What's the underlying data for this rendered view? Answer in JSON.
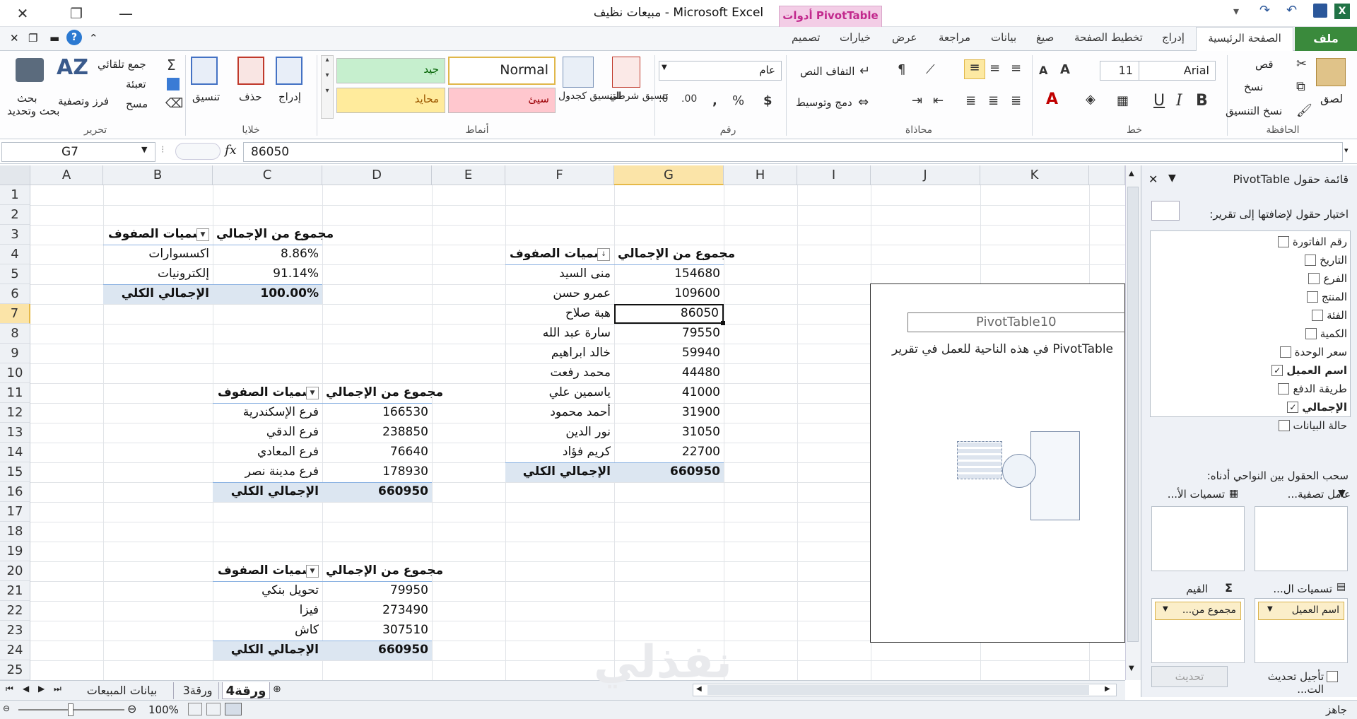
{
  "window": {
    "title": "مبيعات نظيف  -  Microsoft Excel",
    "context_tab": "أدوات PivotTable"
  },
  "tabs": {
    "file": "ملف",
    "home": "الصفحة الرئيسية",
    "insert": "إدراج",
    "page_layout": "تخطيط الصفحة",
    "formulas": "صيغ",
    "data": "بيانات",
    "review": "مراجعة",
    "view": "عرض",
    "options": "خيارات",
    "design": "تصميم"
  },
  "ribbon": {
    "clipboard": {
      "label": "الحافظة",
      "paste": "لصق",
      "cut": "قص",
      "copy": "نسخ",
      "format_painter": "نسخ التنسيق"
    },
    "font": {
      "label": "خط",
      "name": "Arial",
      "size": "11",
      "bold": "B",
      "italic": "I",
      "underline": "U"
    },
    "alignment": {
      "label": "محاذاة",
      "wrap": "التفاف النص",
      "merge": "دمج وتوسيط"
    },
    "number": {
      "label": "رقم",
      "format": "عام"
    },
    "styles": {
      "label": "أنماط",
      "conditional": "تنسيق شرطي",
      "as_table": "التنسيق كجدول",
      "normal": "Normal",
      "good": "جيد",
      "bad": "سيئ",
      "neutral": "محايد"
    },
    "cells": {
      "label": "خلايا",
      "insert": "إدراج",
      "delete": "حذف",
      "format": "تنسيق"
    },
    "editing": {
      "label": "تحرير",
      "autosum": "جمع تلقائي",
      "fill": "تعبئة",
      "clear": "مسح",
      "sort": "فرز وتصفية",
      "find": "بحث وتحديد"
    }
  },
  "formula_bar": {
    "namebox": "G7",
    "fx": "fx",
    "value": "86050"
  },
  "columns": [
    "A",
    "B",
    "C",
    "D",
    "E",
    "F",
    "G",
    "H",
    "I",
    "J",
    "K"
  ],
  "rows": [
    "1",
    "2",
    "3",
    "4",
    "5",
    "6",
    "7",
    "8",
    "9",
    "10",
    "11",
    "12",
    "13",
    "14",
    "15",
    "16",
    "17",
    "18",
    "19",
    "20",
    "21",
    "22",
    "23",
    "24",
    "25"
  ],
  "pivot1": {
    "header_sum": "مجموع من الإجمالي",
    "header_rows": "تسميات الصفوف",
    "rows": [
      {
        "label": "اكسسوارات",
        "value": "8.86%"
      },
      {
        "label": "إلكترونيات",
        "value": "91.14%"
      }
    ],
    "total_label": "الإجمالي الكلي",
    "total_value": "100.00%"
  },
  "pivot2": {
    "header_sum": "مجموع من الإجمالي",
    "header_rows": "تسميات الصفوف",
    "rows": [
      {
        "label": "فرع الإسكندرية",
        "value": "166530"
      },
      {
        "label": "فرع الدقي",
        "value": "238850"
      },
      {
        "label": "فرع المعادي",
        "value": "76640"
      },
      {
        "label": "فرع مدينة نصر",
        "value": "178930"
      }
    ],
    "total_label": "الإجمالي الكلي",
    "total_value": "660950"
  },
  "pivot3": {
    "header_sum": "مجموع من الإجمالي",
    "header_rows": "تسميات الصفوف",
    "rows": [
      {
        "label": "تحويل بنكي",
        "value": "79950"
      },
      {
        "label": "فيزا",
        "value": "273490"
      },
      {
        "label": "كاش",
        "value": "307510"
      }
    ],
    "total_label": "الإجمالي الكلي",
    "total_value": "660950"
  },
  "pivot4": {
    "header_sum": "مجموع من الإجمالي",
    "header_rows": "تسميات الصفوف",
    "rows": [
      {
        "label": "منى السيد",
        "value": "154680"
      },
      {
        "label": "عمرو حسن",
        "value": "109600"
      },
      {
        "label": "هبة صلاح",
        "value": "86050"
      },
      {
        "label": "سارة عبد الله",
        "value": "79550"
      },
      {
        "label": "خالد ابراهيم",
        "value": "59940"
      },
      {
        "label": "محمد رفعت",
        "value": "44480"
      },
      {
        "label": "ياسمين علي",
        "value": "41000"
      },
      {
        "label": "أحمد محمود",
        "value": "31900"
      },
      {
        "label": "نور الدين",
        "value": "31050"
      },
      {
        "label": "كريم فؤاد",
        "value": "22700"
      }
    ],
    "total_label": "الإجمالي الكلي",
    "total_value": "660950"
  },
  "placeholder": {
    "name": "PivotTable10",
    "hint": "PivotTable  في هذه الناحية للعمل في تقرير"
  },
  "field_pane": {
    "title": "قائمة حقول PivotTable",
    "choose_label": "اختيار حقول لإضافتها إلى تقرير:",
    "fields": [
      {
        "name": "رقم الفاتورة",
        "checked": false
      },
      {
        "name": "التاريخ",
        "checked": false
      },
      {
        "name": "الفرع",
        "checked": false
      },
      {
        "name": "المنتج",
        "checked": false
      },
      {
        "name": "الفئة",
        "checked": false
      },
      {
        "name": "الكمية",
        "checked": false
      },
      {
        "name": "سعر الوحدة",
        "checked": false
      },
      {
        "name": "اسم العميل",
        "checked": true
      },
      {
        "name": "طريقة الدفع",
        "checked": false
      },
      {
        "name": "الإجمالي",
        "checked": true
      },
      {
        "name": "حالة البيانات",
        "checked": false
      }
    ],
    "drag_label": "سحب الحقول بين النواحي أدناه:",
    "area_filter": "عامل تصفية...",
    "area_columns": "تسميات الأ...",
    "area_rows": "تسميات ال...",
    "area_values": "القيم",
    "row_item": "اسم العميل",
    "value_item": "مجموع من...",
    "defer_label": "تأجيل تحديث الت...",
    "update_button": "تحديث"
  },
  "sheets": {
    "tabs": [
      "بيانات المبيعات",
      "ورقة3",
      "ورقة4"
    ],
    "active": "ورقة4"
  },
  "status": {
    "ready": "جاهز",
    "zoom": "100%"
  },
  "watermark": "نفذلي"
}
